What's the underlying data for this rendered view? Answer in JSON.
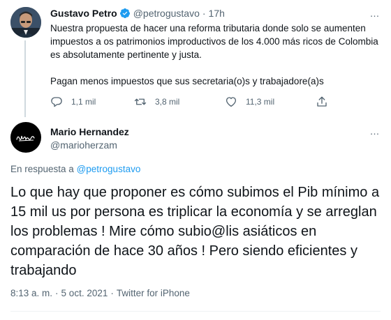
{
  "parent_tweet": {
    "name": "Gustavo Petro",
    "handle": "@petrogustavo",
    "separator": "·",
    "time": "17h",
    "paragraphs": [
      "Nuestra propuesta de hacer una reforma tributaria donde solo se aumenten impuestos a os patrimonios improductivos de los 4.000 más ricos de Colombia es absolutamente pertinente y justa.",
      "Pagan menos impuestos que sus secretaria(o)s y trabajadore(a)s"
    ],
    "stats": {
      "replies": "1,1 mil",
      "retweets": "3,8 mil",
      "likes": "11,3 mil"
    }
  },
  "reply_tweet": {
    "name": "Mario Hernandez",
    "handle": "@marioherzam",
    "reply_prefix": "En respuesta a",
    "reply_to": "@petrogustavo",
    "text": "Lo que hay que proponer es cómo subimos el Pib mínimo a 15 mil us por persona es triplicar la economía y se arreglan los problemas ! Mire cómo subio@lis asiáticos en comparación de hace 30 años ! Pero siendo eficientes y trabajando",
    "time": "8:13 a. m.",
    "date": "5 oct. 2021",
    "source": "Twitter for iPhone",
    "separator": "·"
  },
  "more_icon": "…",
  "icons": {
    "verified": "verified-badge-icon",
    "reply": "reply-icon",
    "retweet": "retweet-icon",
    "like": "heart-icon",
    "share": "share-icon",
    "more": "more-icon"
  },
  "colors": {
    "accent": "#1d9bf0",
    "secondary_text": "#536471",
    "primary_text": "#0f1419"
  }
}
